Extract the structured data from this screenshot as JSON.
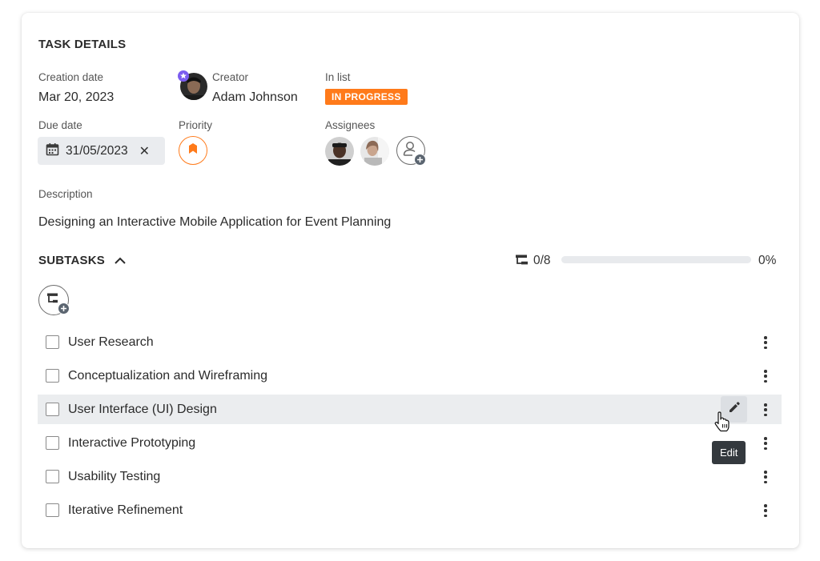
{
  "task": {
    "header_title": "TASK DETAILS",
    "creation_date_label": "Creation date",
    "creation_date": "Mar 20, 2023",
    "creator_label": "Creator",
    "creator_name": "Adam Johnson",
    "in_list_label": "In list",
    "in_list_status": "IN PROGRESS",
    "due_date_label": "Due date",
    "due_date": "31/05/2023",
    "priority_label": "Priority",
    "assignees_label": "Assignees",
    "description_label": "Description",
    "description": "Designing an Interactive Mobile Application for Event Planning"
  },
  "subtasks": {
    "title": "SUBTASKS",
    "count": "0/8",
    "progress_text": "0%",
    "progress_fraction": 0,
    "items": [
      {
        "label": "User Research"
      },
      {
        "label": "Conceptualization and Wireframing"
      },
      {
        "label": "User Interface (UI) Design"
      },
      {
        "label": "Interactive Prototyping"
      },
      {
        "label": "Usability Testing"
      },
      {
        "label": "Iterative Refinement"
      }
    ]
  },
  "tooltip": {
    "text": "Edit"
  },
  "icons": {
    "creator_badge": "star-badge-icon",
    "due_date": "calendar-icon",
    "clear": "close-icon",
    "priority": "priority-flag-icon",
    "add_assignee": "add-user-icon",
    "collapse": "chevron-up-icon",
    "subtask": "subtask-icon",
    "add_subtask": "add-subtask-icon",
    "more": "more-vertical-icon",
    "edit": "pencil-icon",
    "cursor": "hand-pointer-icon"
  },
  "colors": {
    "accent": "#ff7a1a",
    "badge": "#7b5cf0",
    "hover_row": "#ebedef",
    "tooltip_bg": "#34393e"
  }
}
